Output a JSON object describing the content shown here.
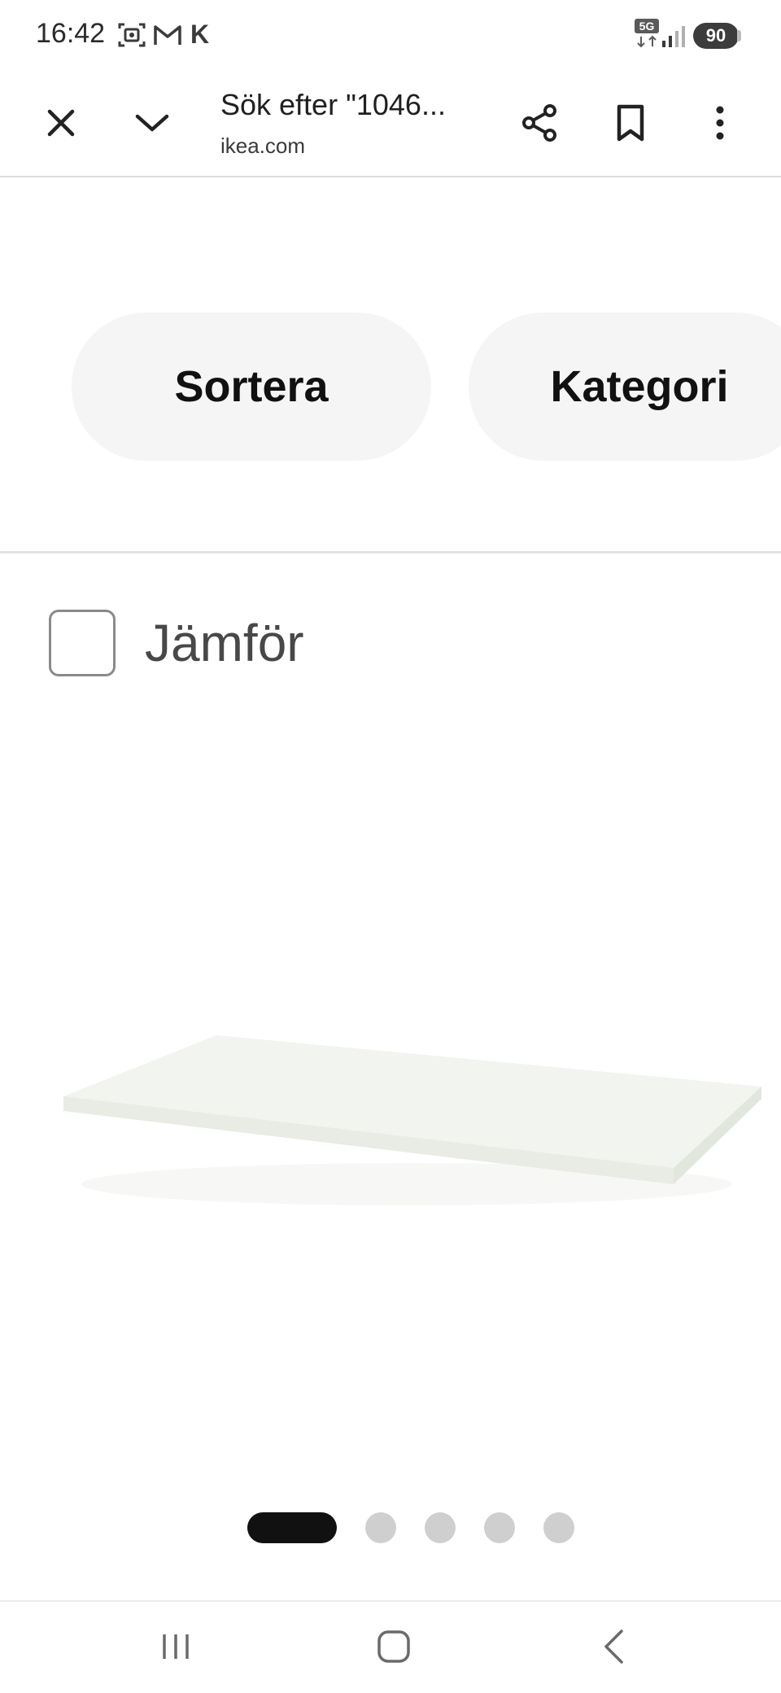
{
  "status_bar": {
    "time": "16:42",
    "carrier_letter": "K",
    "network": "5G",
    "battery": "90",
    "icons": [
      "screenshot-icon",
      "gmail-icon",
      "signal-icon"
    ]
  },
  "toolbar": {
    "title": "Sök efter \"1046...",
    "url": "ikea.com",
    "icons": [
      "close-icon",
      "chevron-down-icon",
      "share-icon",
      "bookmark-icon",
      "more-vertical-icon"
    ]
  },
  "filters": {
    "sort_label": "Sortera",
    "category_label": "Kategori"
  },
  "compare": {
    "label": "Jämför",
    "checked": false
  },
  "product": {
    "image": "white-shelf-image"
  },
  "pagination": {
    "total": 5,
    "active_index": 0
  },
  "navbar": {
    "icons": [
      "recent-apps-icon",
      "home-icon",
      "back-icon"
    ]
  },
  "colors": {
    "pill_bg": "#f5f5f5",
    "active_dot": "#111111",
    "inactive_dot": "#cfcfcf"
  }
}
